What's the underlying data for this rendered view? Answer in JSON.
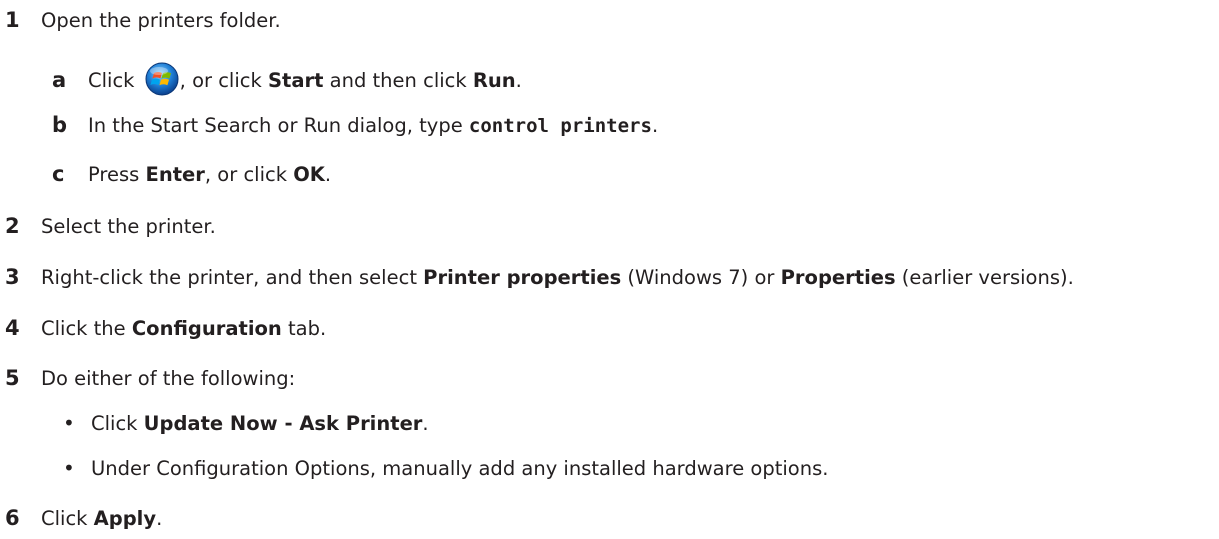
{
  "steps": [
    {
      "num": "1",
      "text": "Open the printers folder."
    },
    {
      "num": "2",
      "text": "Select the printer."
    },
    {
      "num": "3",
      "pre": "Right‑click the printer, and then select ",
      "b1": "Printer properties",
      "mid": " (Windows 7) or ",
      "b2": "Properties",
      "post": " (earlier versions)."
    },
    {
      "num": "4",
      "pre": "Click the ",
      "b1": "Configuration",
      "post": " tab."
    },
    {
      "num": "5",
      "text": "Do either of the following:"
    },
    {
      "num": "6",
      "pre": "Click ",
      "b1": "Apply",
      "post": "."
    }
  ],
  "substeps": [
    {
      "letter": "a",
      "pre": "Click ",
      "mid": ", or click ",
      "b1": "Start",
      "mid2": " and then click ",
      "b2": "Run",
      "post": "."
    },
    {
      "letter": "b",
      "pre": "In the Start Search or Run dialog, type ",
      "code": "control printers",
      "post": "."
    },
    {
      "letter": "c",
      "pre": "Press ",
      "b1": "Enter",
      "mid": ", or click ",
      "b2": "OK",
      "post": "."
    }
  ],
  "bullets": [
    {
      "symbol": "•",
      "pre": "Click ",
      "b1": "Update Now ‑ Ask Printer",
      "post": "."
    },
    {
      "symbol": "•",
      "text": "Under Configuration Options, manually add any installed hardware options."
    }
  ],
  "icons": {
    "start_button": "windows-start-orb-icon"
  }
}
